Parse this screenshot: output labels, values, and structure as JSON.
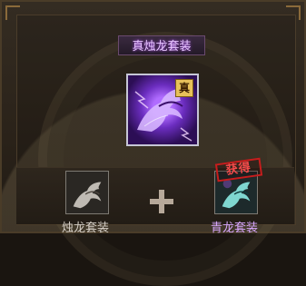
{
  "title": "真烛龙套装",
  "main_item": {
    "badge": "真"
  },
  "left_item": {
    "name": "烛龙套装"
  },
  "right_item": {
    "name": "青龙套装",
    "stamp": "获得"
  },
  "colors": {
    "title_glow": "#b04dff",
    "stamp_red": "#c61d1d",
    "purple_item": "#6b2dbf"
  },
  "icons": {
    "main": "purple-dragon-icon",
    "left": "gray-dragon-icon",
    "right": "teal-dragon-icon",
    "plus": "plus-icon"
  }
}
